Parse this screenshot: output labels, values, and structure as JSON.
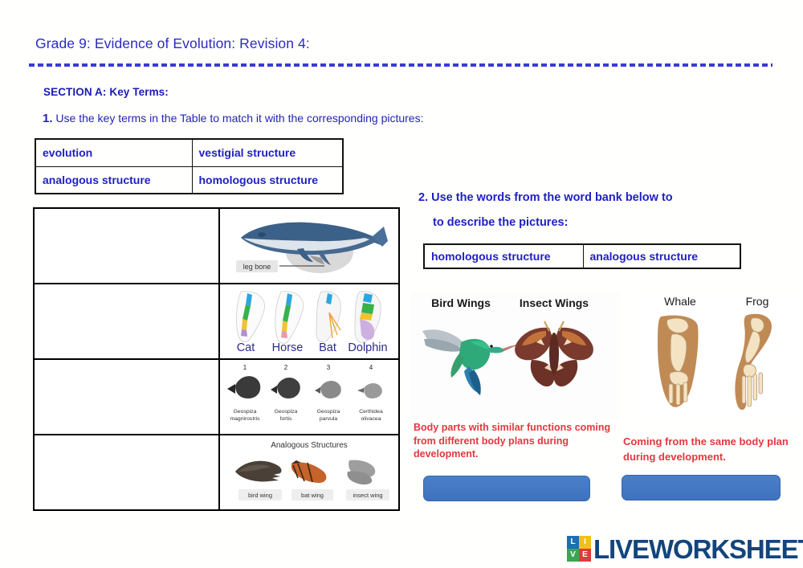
{
  "header": {
    "title": "Grade 9: Evidence of Evolution: Revision 4:",
    "section_label": "SECTION A: Key Terms:",
    "accent_blue": "#2323b9",
    "rule_color": "#3b3bd4"
  },
  "question1": {
    "number": "1.",
    "text": "Use the key terms in the Table to match it with the corresponding pictures:",
    "key_terms": [
      [
        "evolution",
        "vestigial structure"
      ],
      [
        "analogous structure",
        "homologous structure"
      ]
    ],
    "rows": [
      {
        "answer_placeholder": "",
        "picture_name": "whale-vestigial-leg-bone",
        "picture_caption": "leg bone"
      },
      {
        "answer_placeholder": "",
        "picture_name": "mammal-forelimb-comparison",
        "picture_labels": [
          "Cat",
          "Horse",
          "Bat",
          "Dolphin"
        ]
      },
      {
        "answer_placeholder": "",
        "picture_name": "darwin-finch-beaks",
        "picture_numbers": [
          "1",
          "2",
          "3",
          "4"
        ],
        "picture_labels": [
          "Geospiza\nmagnirostris",
          "Geospiza\nfortis",
          "Geospiza\nparvula",
          "Certhidea\nolivacea"
        ]
      },
      {
        "answer_placeholder": "",
        "picture_name": "analogous-wings",
        "picture_title": "Analogous Structures",
        "picture_labels": [
          "bird wing",
          "bat wing",
          "insect wing"
        ]
      }
    ]
  },
  "question2": {
    "number": "2.",
    "line1": "Use the words from the word bank below to",
    "line2": "to describe the pictures:",
    "word_bank": [
      "homologous structure",
      "analogous structure"
    ],
    "items": [
      {
        "figure_name": "bird-and-insect-wings",
        "figure_labels": [
          "Bird Wings",
          "Insect Wings"
        ],
        "caption": "Body parts with similar functions coming from different body plans during development.",
        "answer_value": ""
      },
      {
        "figure_name": "whale-and-frog-forelimbs",
        "figure_labels": [
          "Whale",
          "Frog"
        ],
        "caption": "Coming from the same body plan during development.",
        "answer_value": ""
      }
    ],
    "caption_color": "#e1383f",
    "dropbox_color": "#4a7fc8"
  },
  "footer": {
    "logo_tiles": [
      "L",
      "I",
      "V",
      "E"
    ],
    "logo_text": "LIVEWORKSHEETS",
    "logo_text_color": "#12457c"
  }
}
